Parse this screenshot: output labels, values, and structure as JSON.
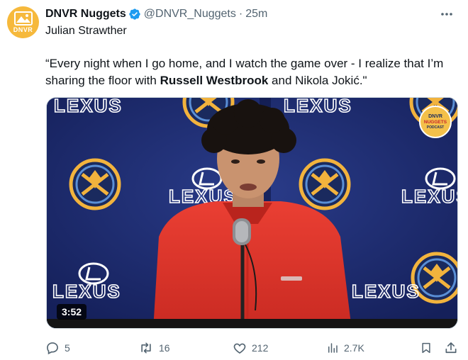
{
  "tweet": {
    "author": {
      "avatar_text": "DNVR",
      "display_name": "DNVR Nuggets",
      "verified": true,
      "handle": "@DNVR_Nuggets",
      "separator": "·",
      "time": "25m"
    },
    "subtitle": "Julian Strawther",
    "body": {
      "part1": "“Every night when I go home, and I watch the game over  - I realize that I’m sharing the floor with ",
      "bold1": "Russell Westbrook",
      "part2": " and Nikola Jokić.\""
    },
    "media": {
      "type": "video",
      "duration": "3:52",
      "backdrop_brand": "LEXUS",
      "corner_badge_lines": [
        "DNVR",
        "NUGGETS",
        "PODCAST"
      ]
    },
    "actions": {
      "replies": "5",
      "retweets": "16",
      "likes": "212",
      "views": "2.7K"
    }
  },
  "colors": {
    "text": "#0f1419",
    "secondary": "#536471",
    "verified_blue": "#1d9bf0",
    "avatar_gold": "#f6b93c",
    "backdrop_navy": "#1d2b6c",
    "jacket_red": "#e2332a"
  },
  "icons": [
    "verified-badge-icon",
    "more-icon",
    "reply-icon",
    "retweet-icon",
    "like-icon",
    "views-icon",
    "bookmark-icon",
    "share-icon"
  ]
}
